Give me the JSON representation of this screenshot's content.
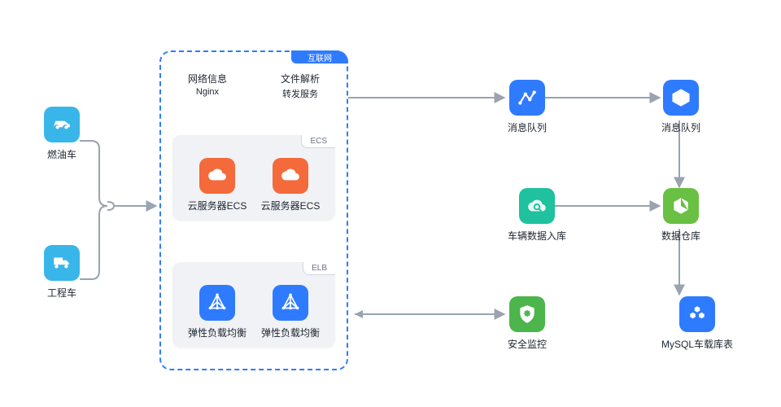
{
  "sources": {
    "car": {
      "label": "燃油车"
    },
    "truck": {
      "label": "工程车"
    }
  },
  "center": {
    "tab": "互联网",
    "header": {
      "left_title": "网络信息",
      "left_sub": "Nginx",
      "right_title": "文件解析",
      "right_sub": "转发服务"
    },
    "ecs": {
      "tag": "ECS",
      "item1": "云服务器ECS",
      "item2": "云服务器ECS"
    },
    "elb": {
      "tag": "ELB",
      "item1": "弹性负载均衡",
      "item2": "弹性负载均衡"
    }
  },
  "right": {
    "node1": "消息队列",
    "node2": "消息队列",
    "node3": "车辆数据入库",
    "node4": "数据仓库",
    "node5": "安全监控",
    "node6": "MySQL车载库表"
  }
}
